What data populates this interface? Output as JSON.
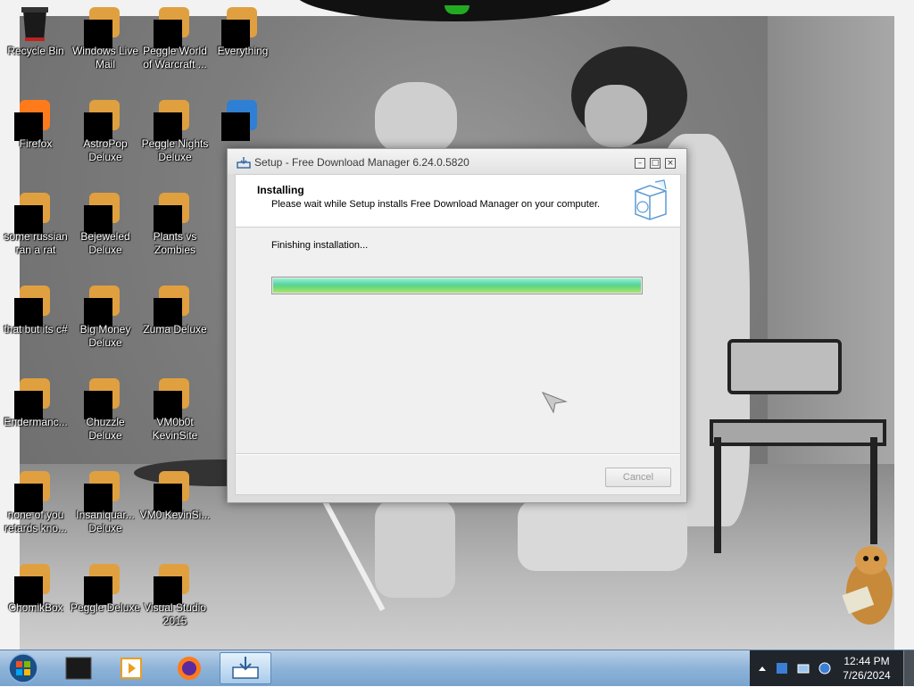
{
  "desktop": {
    "icons": [
      {
        "label": "Recycle Bin",
        "icon": "recycle-bin-icon",
        "masked": false
      },
      {
        "label": "Windows Live Mail",
        "icon": "mail-icon",
        "masked": true
      },
      {
        "label": "Peggle World of Warcraft ...",
        "icon": "peggle-wow-icon",
        "masked": true
      },
      {
        "label": "Everything",
        "icon": "search-everything-icon",
        "masked": true
      },
      {
        "label": "Firefox",
        "icon": "firefox-icon",
        "masked": true
      },
      {
        "label": "AstroPop Deluxe",
        "icon": "astropop-icon",
        "masked": true
      },
      {
        "label": "Peggle Nights Deluxe",
        "icon": "peggle-nights-icon",
        "masked": true
      },
      {
        "label": "",
        "icon": "globe-icon",
        "masked": true
      },
      {
        "label": "some russian ran a rat",
        "icon": "document-icon",
        "masked": true
      },
      {
        "label": "Bejeweled Deluxe",
        "icon": "bejeweled-icon",
        "masked": true
      },
      {
        "label": "Plants vs Zombies",
        "icon": "plants-vs-zombies-icon",
        "masked": true
      },
      {
        "label": "that but its c#",
        "icon": "file-icon",
        "masked": true
      },
      {
        "label": "Big Money Deluxe",
        "icon": "big-money-icon",
        "masked": true
      },
      {
        "label": "Zuma Deluxe",
        "icon": "zuma-icon",
        "masked": true
      },
      {
        "label": "Endermanc...",
        "icon": "app-icon",
        "masked": true
      },
      {
        "label": "Chuzzle Deluxe",
        "icon": "chuzzle-icon",
        "masked": true
      },
      {
        "label": "VM0b0t KevinSite",
        "icon": "vm-icon",
        "masked": true
      },
      {
        "label": "none of you retards kno...",
        "icon": "app-icon",
        "masked": true
      },
      {
        "label": "Insaniquar... Deluxe",
        "icon": "insaniquarium-icon",
        "masked": true
      },
      {
        "label": "VM0 KevinSi...",
        "icon": "vm-icon",
        "masked": true
      },
      {
        "label": "ChomikBox",
        "icon": "chomikbox-icon",
        "masked": true
      },
      {
        "label": "Peggle Deluxe",
        "icon": "peggle-icon",
        "masked": true
      },
      {
        "label": "Visual Studio 2015",
        "icon": "visual-studio-icon",
        "masked": true
      }
    ]
  },
  "window": {
    "title": "Setup - Free Download Manager 6.24.0.5820",
    "header_title": "Installing",
    "header_subtitle": "Please wait while Setup installs Free Download Manager on your computer.",
    "status_text": "Finishing installation...",
    "progress": 1.0,
    "cancel_label": "Cancel",
    "cancel_enabled": false,
    "colors": {
      "progress_start": "#55d7a6",
      "progress_end": "#a7e76b"
    }
  },
  "taskbar": {
    "items": [
      "start-orb",
      "terminal",
      "media-player",
      "firefox",
      "setup-installer"
    ],
    "clock_time": "12:44 PM",
    "clock_date": "7/26/2024"
  }
}
